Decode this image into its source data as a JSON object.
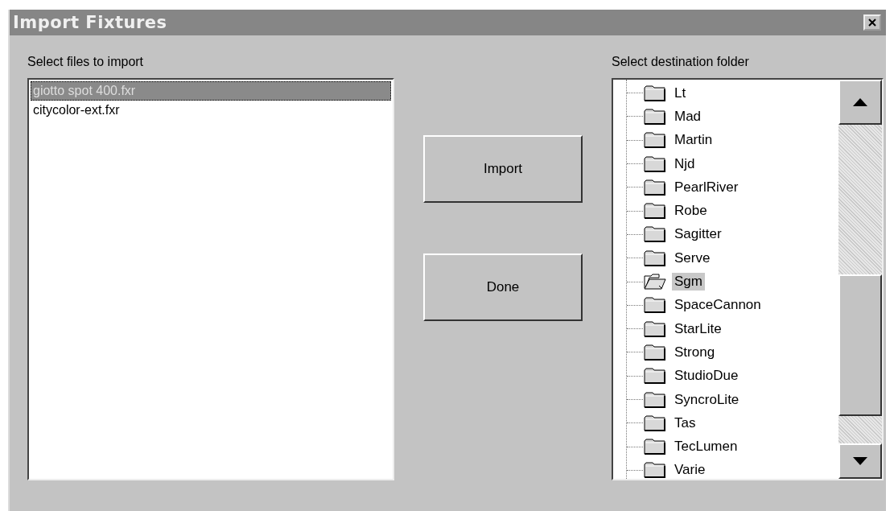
{
  "window": {
    "title": "Import Fixtures"
  },
  "files": {
    "label": "Select files to import",
    "items": [
      {
        "name": "giotto spot 400.fxr",
        "selected": true
      },
      {
        "name": "citycolor-ext.fxr",
        "selected": false
      }
    ]
  },
  "buttons": [
    "Import",
    "Done"
  ],
  "folders": {
    "label": "Select destination folder",
    "items": [
      {
        "name": "Lt",
        "selected": false
      },
      {
        "name": "Mad",
        "selected": false
      },
      {
        "name": "Martin",
        "selected": false
      },
      {
        "name": "Njd",
        "selected": false
      },
      {
        "name": "PearlRiver",
        "selected": false
      },
      {
        "name": "Robe",
        "selected": false
      },
      {
        "name": "Sagitter",
        "selected": false
      },
      {
        "name": "Serve",
        "selected": false
      },
      {
        "name": "Sgm",
        "selected": true
      },
      {
        "name": "SpaceCannon",
        "selected": false
      },
      {
        "name": "StarLite",
        "selected": false
      },
      {
        "name": "Strong",
        "selected": false
      },
      {
        "name": "StudioDue",
        "selected": false
      },
      {
        "name": "SyncroLite",
        "selected": false
      },
      {
        "name": "Tas",
        "selected": false
      },
      {
        "name": "TecLumen",
        "selected": false
      },
      {
        "name": "Varie",
        "selected": false
      }
    ]
  }
}
